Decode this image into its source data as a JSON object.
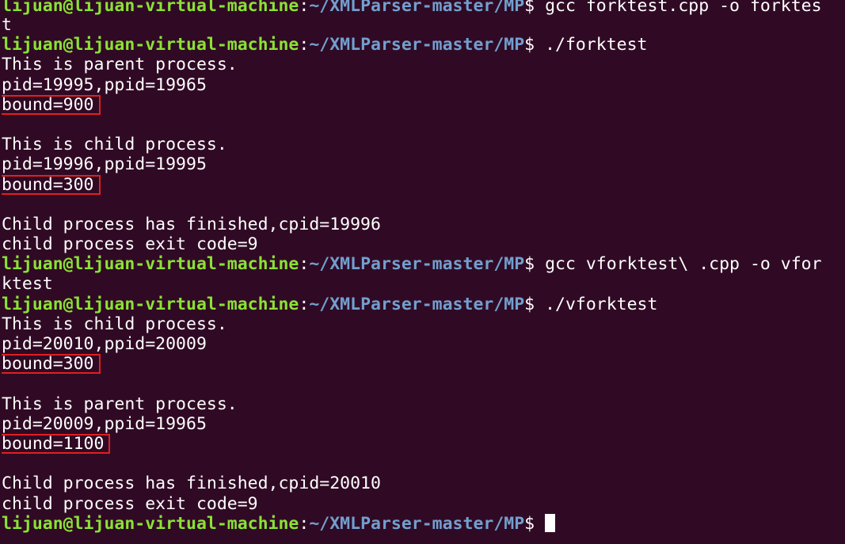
{
  "prompt": {
    "user_host": "lijuan@lijuan-virtual-machine",
    "colon": ":",
    "path": "~/XMLParser-master/MP",
    "dollar": "$ "
  },
  "lines": [
    {
      "kind": "prompt",
      "cmd": "gcc forktest.cpp -o forktes"
    },
    {
      "kind": "out",
      "text": "t"
    },
    {
      "kind": "prompt",
      "cmd": "./forktest"
    },
    {
      "kind": "out",
      "text": "This is parent process."
    },
    {
      "kind": "out",
      "text": "pid=19995,ppid=19965"
    },
    {
      "kind": "boxed",
      "text": "bound=900"
    },
    {
      "kind": "out",
      "text": ""
    },
    {
      "kind": "out",
      "text": "This is child process."
    },
    {
      "kind": "out",
      "text": "pid=19996,ppid=19995"
    },
    {
      "kind": "boxed",
      "text": "bound=300"
    },
    {
      "kind": "out",
      "text": ""
    },
    {
      "kind": "out",
      "text": "Child process has finished,cpid=19996"
    },
    {
      "kind": "out",
      "text": "child process exit code=9"
    },
    {
      "kind": "prompt",
      "cmd": "gcc vforktest\\ .cpp -o vfor"
    },
    {
      "kind": "out",
      "text": "ktest"
    },
    {
      "kind": "prompt",
      "cmd": "./vforktest"
    },
    {
      "kind": "out",
      "text": "This is child process."
    },
    {
      "kind": "out",
      "text": "pid=20010,ppid=20009"
    },
    {
      "kind": "boxed",
      "text": "bound=300"
    },
    {
      "kind": "out",
      "text": ""
    },
    {
      "kind": "out",
      "text": "This is parent process."
    },
    {
      "kind": "out",
      "text": "pid=20009,ppid=19965"
    },
    {
      "kind": "boxed",
      "text": "bound=1100"
    },
    {
      "kind": "out",
      "text": ""
    },
    {
      "kind": "out",
      "text": "Child process has finished,cpid=20010"
    },
    {
      "kind": "out",
      "text": "child process exit code=9"
    },
    {
      "kind": "prompt",
      "cmd": "",
      "cursor": true
    }
  ],
  "colors": {
    "background": "#300a24",
    "user_host": "#8ae234",
    "path": "#729fcf",
    "text": "#ffffff",
    "highlight_box": "#e02020"
  }
}
